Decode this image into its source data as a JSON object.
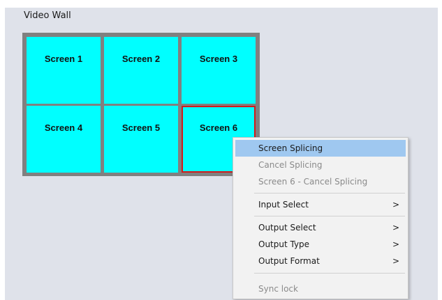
{
  "panel": {
    "title": "Video Wall"
  },
  "screens": [
    {
      "label": "Screen 1"
    },
    {
      "label": "Screen 2"
    },
    {
      "label": "Screen 3"
    },
    {
      "label": "Screen 4"
    },
    {
      "label": "Screen 5"
    },
    {
      "label": "Screen 6",
      "selected": true
    }
  ],
  "context_menu": {
    "items": [
      {
        "label": "Screen Splicing",
        "enabled": true,
        "highlighted": true
      },
      {
        "label": "Cancel Splicing",
        "enabled": false
      },
      {
        "label": "Screen 6 - Cancel Splicing",
        "enabled": false
      },
      {
        "label": "Input Select",
        "enabled": true,
        "submenu_arrow": ">"
      },
      {
        "label": "Output Select",
        "enabled": true,
        "submenu_arrow": ">"
      },
      {
        "label": "Output Type",
        "enabled": true,
        "submenu_arrow": ">"
      },
      {
        "label": "Output Format",
        "enabled": true,
        "submenu_arrow": ">"
      },
      {
        "label": "Sync lock",
        "enabled": false
      }
    ]
  },
  "colors": {
    "panel_bg": "#dfe2ea",
    "screen_fill": "#00ffff",
    "grid_border": "#808080",
    "selected_border": "#d11a1a",
    "menu_highlight": "#9fc8f0",
    "disabled_text": "#8a8a8a"
  }
}
